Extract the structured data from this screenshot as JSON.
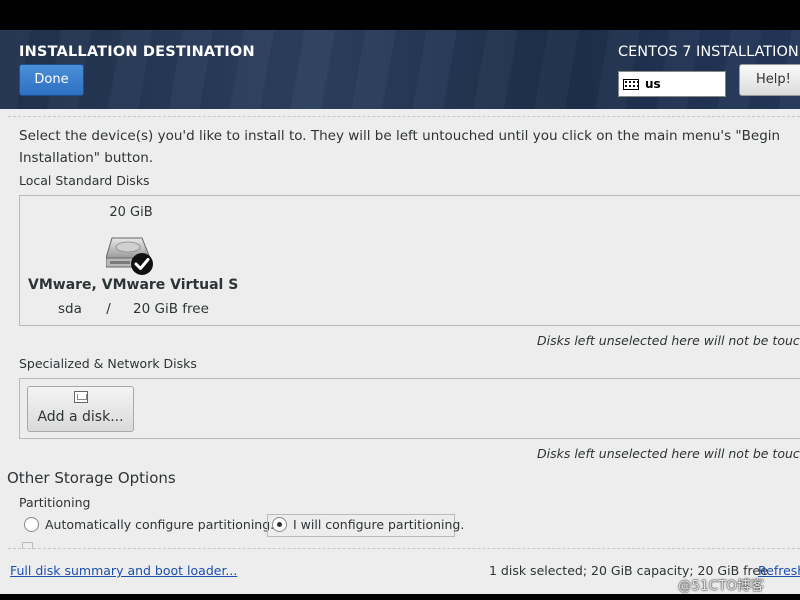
{
  "header": {
    "page_title": "INSTALLATION DESTINATION",
    "done_label": "Done",
    "product_title": "CENTOS 7 INSTALLATION",
    "keyboard_layout": "us",
    "help_label": "Help!"
  },
  "instructions": "Select the device(s) you'd like to install to.  They will be left untouched until you click on the main menu's \"Begin Installation\" button.",
  "local_disks": {
    "label": "Local Standard Disks",
    "disks": [
      {
        "size": "20 GiB",
        "name": "VMware, VMware Virtual S",
        "device": "sda",
        "separator": "/",
        "free": "20 GiB free",
        "selected": true
      }
    ],
    "note": "Disks left unselected here will not be touched."
  },
  "network_disks": {
    "label": "Specialized & Network Disks",
    "add_disk_label": "Add a disk...",
    "note": "Disks left unselected here will not be touched."
  },
  "other_storage": {
    "title": "Other Storage Options",
    "partitioning_label": "Partitioning",
    "auto_option": "Automatically configure partitioning.",
    "manual_option": "I will configure partitioning.",
    "selected": "manual"
  },
  "footer": {
    "summary_link": "Full disk summary and boot loader...",
    "status": "1 disk selected; 20 GiB capacity; 20 GiB free",
    "refresh_link": "Refresh..."
  },
  "watermark": "@51CTO博客",
  "colors": {
    "header_bg": "#24375a",
    "done_button": "#3a7fcf",
    "content_bg": "#ededed",
    "link": "#1c4fb0"
  }
}
